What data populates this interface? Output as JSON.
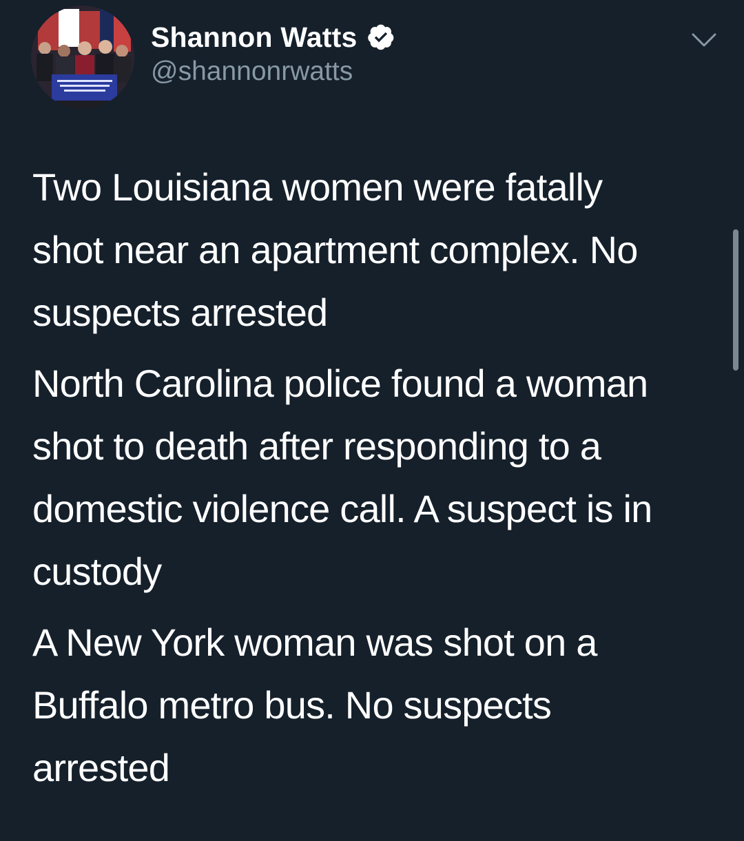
{
  "author": {
    "display_name": "Shannon Watts",
    "handle": "@shannonrwatts",
    "verified": true
  },
  "icons": {
    "verified": "verified-badge-icon",
    "menu": "chevron-down-icon"
  },
  "tweet": {
    "lines": [
      [
        "Two Louisiana women were fatally",
        "shot near an apartment complex. No",
        "suspects arrested"
      ],
      [
        "North Carolina police found a woman",
        "shot to death after responding to a",
        "domestic violence call. A suspect is in",
        "custody"
      ],
      [
        "A New York woman was shot on a",
        "Buffalo metro bus. No suspects",
        "arrested"
      ]
    ]
  },
  "colors": {
    "background": "#15202b",
    "text_primary": "#ffffff",
    "text_secondary": "#8899a6"
  }
}
